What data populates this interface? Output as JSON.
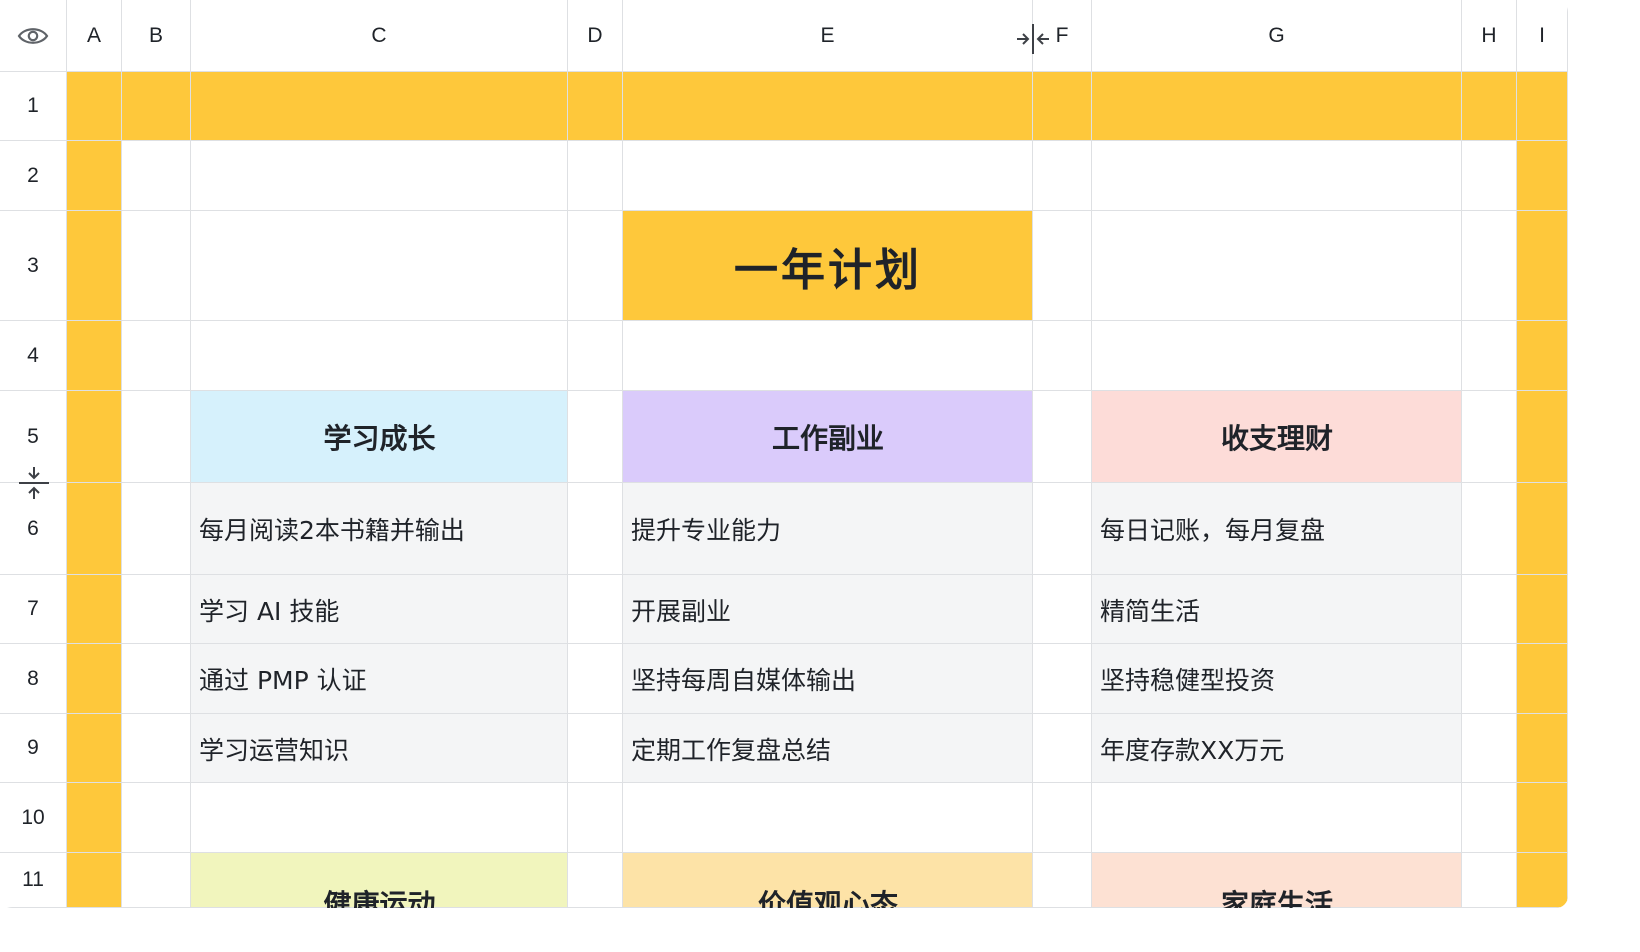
{
  "colors": {
    "yellow": "#fec83b",
    "blue": "#d6f1fc",
    "purple": "#dacbfb",
    "pink": "#fddcd8",
    "gray": "#f4f5f6",
    "lime": "#f1f5bd",
    "peach": "#fde3a7",
    "salmon": "#fde1d3"
  },
  "header": {
    "visibility_icon": "eye-icon",
    "columns": [
      "A",
      "B",
      "C",
      "D",
      "E",
      "F",
      "G",
      "H",
      "I"
    ],
    "rows": [
      "1",
      "2",
      "3",
      "4",
      "5",
      "6",
      "7",
      "8",
      "9",
      "10",
      "11"
    ]
  },
  "sheet": {
    "title": "一年计划",
    "categories": {
      "learning": "学习成长",
      "work": "工作副业",
      "finance": "收支理财",
      "health": "健康运动",
      "values": "价值观心态",
      "family": "家庭生活"
    },
    "learning_items": [
      "每月阅读2本书籍并输出",
      "学习 AI 技能",
      "通过 PMP 认证",
      "学习运营知识"
    ],
    "work_items": [
      "提升专业能力",
      "开展副业",
      "坚持每周自媒体输出",
      "定期工作复盘总结"
    ],
    "finance_items": [
      "每日记账，每月复盘",
      "精简生活",
      "坚持稳健型投资",
      "年度存款XX万元"
    ]
  }
}
